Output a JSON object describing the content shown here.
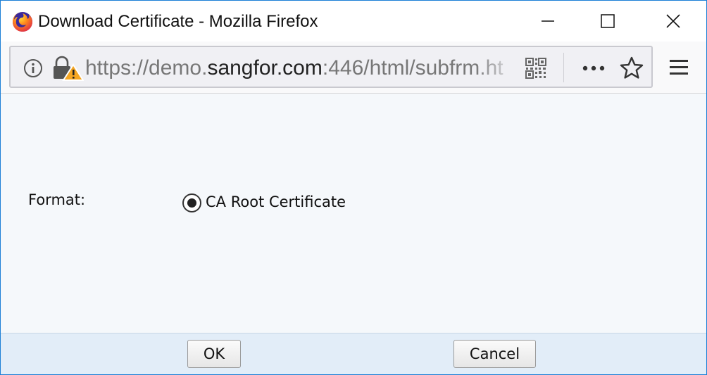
{
  "window": {
    "title": "Download Certificate - Mozilla Firefox"
  },
  "urlbar": {
    "url_prefix": "https://demo.",
    "url_host": "sangfor.com",
    "url_suffix": ":446/html/subfrm.ht"
  },
  "form": {
    "format_label": "Format:",
    "option_label": "CA Root Certificate",
    "option_selected": true
  },
  "footer": {
    "ok_label": "OK",
    "cancel_label": "Cancel"
  },
  "colors": {
    "window_border": "#1b7fd6",
    "content_bg": "#f5f8fb",
    "footer_bg": "#e2edf8",
    "warning": "#f5a623"
  },
  "icons": [
    "firefox-logo-icon",
    "minimize-icon",
    "maximize-icon",
    "close-icon",
    "info-icon",
    "insecure-lock-icon",
    "qr-code-icon",
    "more-icon",
    "star-icon",
    "menu-icon"
  ]
}
